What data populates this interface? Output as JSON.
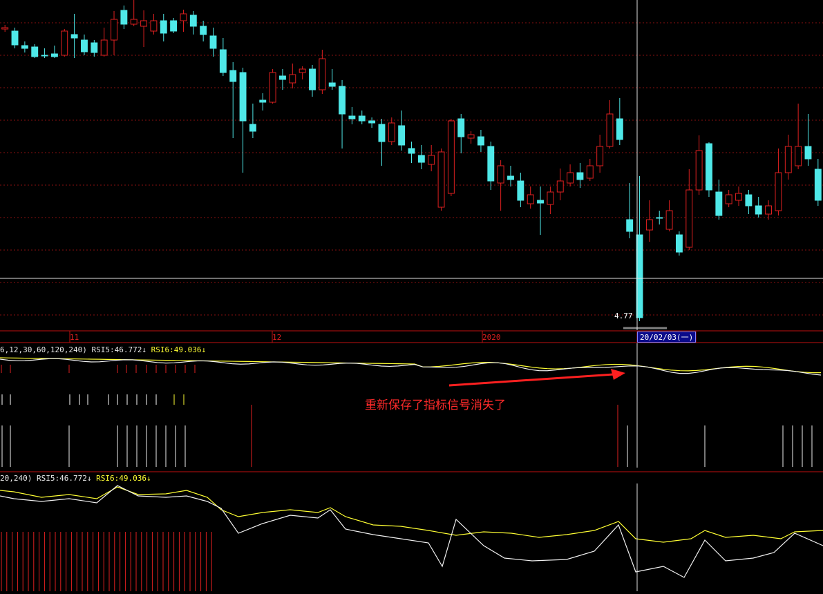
{
  "chart_data": [
    {
      "type": "candlestick",
      "price_label": "4.77",
      "colors": {
        "up": "#e02020",
        "down": "#4fe8e8",
        "background": "#000000",
        "grid": "#8a1010"
      },
      "candles_count": 80
    },
    {
      "type": "line",
      "header_params": "6,12,30,60,120,240)",
      "series": [
        {
          "name": "RSI5",
          "value": "46.772",
          "arrow": "↓"
        },
        {
          "name": "RSI6",
          "value": "49.036",
          "arrow": "↓"
        }
      ]
    },
    {
      "type": "line",
      "header_params": "20,240)",
      "series": [
        {
          "name": "RSI5",
          "value": "46.772",
          "arrow": "↓"
        },
        {
          "name": "RSI6",
          "value": "49.036",
          "arrow": "↓"
        }
      ]
    }
  ],
  "axis": {
    "ticks": [
      {
        "label": "11"
      },
      {
        "label": "12"
      },
      {
        "label": "2020"
      }
    ],
    "cursor_date": "20/02/03(一)"
  },
  "annotation": {
    "text": "重新保存了指标信号消失了"
  }
}
